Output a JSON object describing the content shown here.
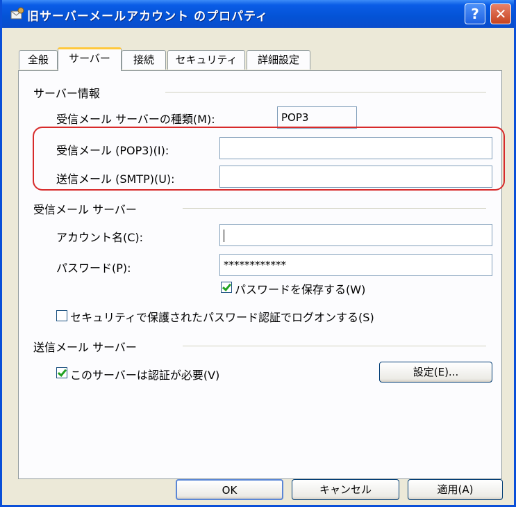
{
  "window": {
    "title": "旧サーバーメールアカウント のプロパティ",
    "help": "?",
    "close": "✕"
  },
  "tabs": [
    "全般",
    "サーバー",
    "接続",
    "セキュリティ",
    "詳細設定"
  ],
  "server_info": {
    "heading": "サーバー情報",
    "type_label": "受信メール サーバーの種類(M):",
    "type_value": "POP3",
    "incoming_label": "受信メール (POP3)(I):",
    "incoming_value": "",
    "outgoing_label": "送信メール (SMTP)(U):",
    "outgoing_value": ""
  },
  "incoming_server": {
    "heading": "受信メール サーバー",
    "account_label": "アカウント名(C):",
    "account_value": "",
    "password_label": "パスワード(P):",
    "password_value": "************",
    "remember_label": "パスワードを保存する(W)",
    "remember_checked": true,
    "spa_label": "セキュリティで保護されたパスワード認証でログオンする(S)",
    "spa_checked": false
  },
  "outgoing_server": {
    "heading": "送信メール サーバー",
    "auth_label": "このサーバーは認証が必要(V)",
    "auth_checked": true,
    "settings_button": "設定(E)..."
  },
  "buttons": {
    "ok": "OK",
    "cancel": "キャンセル",
    "apply": "適用(A)"
  },
  "colors": {
    "titlebar": "#0453d6",
    "highlight": "#d72a2a",
    "active_tab": "#ffc83c"
  }
}
